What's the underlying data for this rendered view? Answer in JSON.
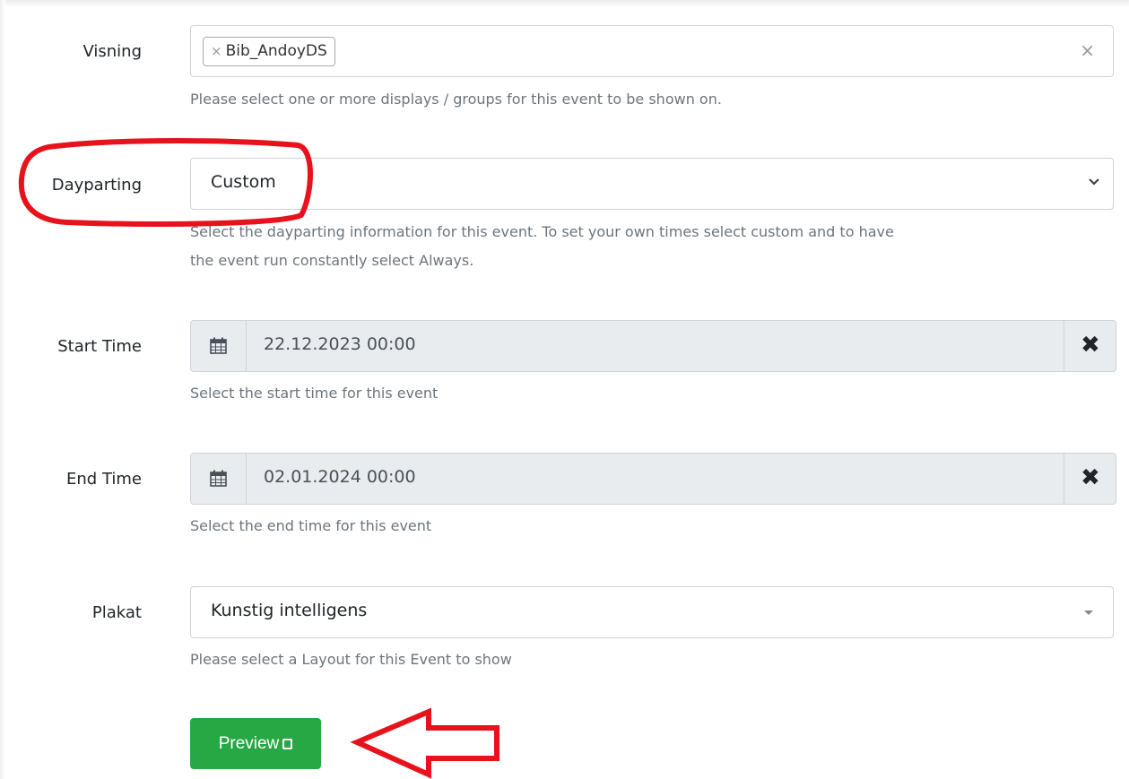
{
  "display_field": {
    "label": "Visning",
    "selected_chip": "Bib_AndoyDS",
    "chip_remove_glyph": "×",
    "clear_glyph": "×",
    "help": "Please select one or more displays / groups for this event to be shown on."
  },
  "dayparting_field": {
    "label": "Dayparting",
    "value": "Custom",
    "help_line1": "Select the dayparting information for this event. To set your own times select custom and to have",
    "help_line2": "the event run constantly select Always."
  },
  "start_time_field": {
    "label": "Start Time",
    "value": "22.12.2023 00:00",
    "clear_glyph": "✖",
    "help": "Select the start time for this event"
  },
  "end_time_field": {
    "label": "End Time",
    "value": "02.01.2024 00:00",
    "clear_glyph": "✖",
    "help": "Select the end time for this event"
  },
  "layout_field": {
    "label": "Plakat",
    "value": "Kunstig intelligens",
    "help": "Please select a Layout for this Event to show"
  },
  "preview_button": {
    "label": "Preview"
  },
  "icons": {
    "calendar": "calendar-icon",
    "chevron": "chevron-down-icon",
    "caret": "caret-down-icon",
    "preview": "square-icon",
    "arrow": "arrow-left-icon"
  },
  "colors": {
    "success": "#28a745",
    "annotation": "#e8121c",
    "muted_text": "#6c757d",
    "border": "#ced4da",
    "readonly_bg": "#e9ecef"
  }
}
